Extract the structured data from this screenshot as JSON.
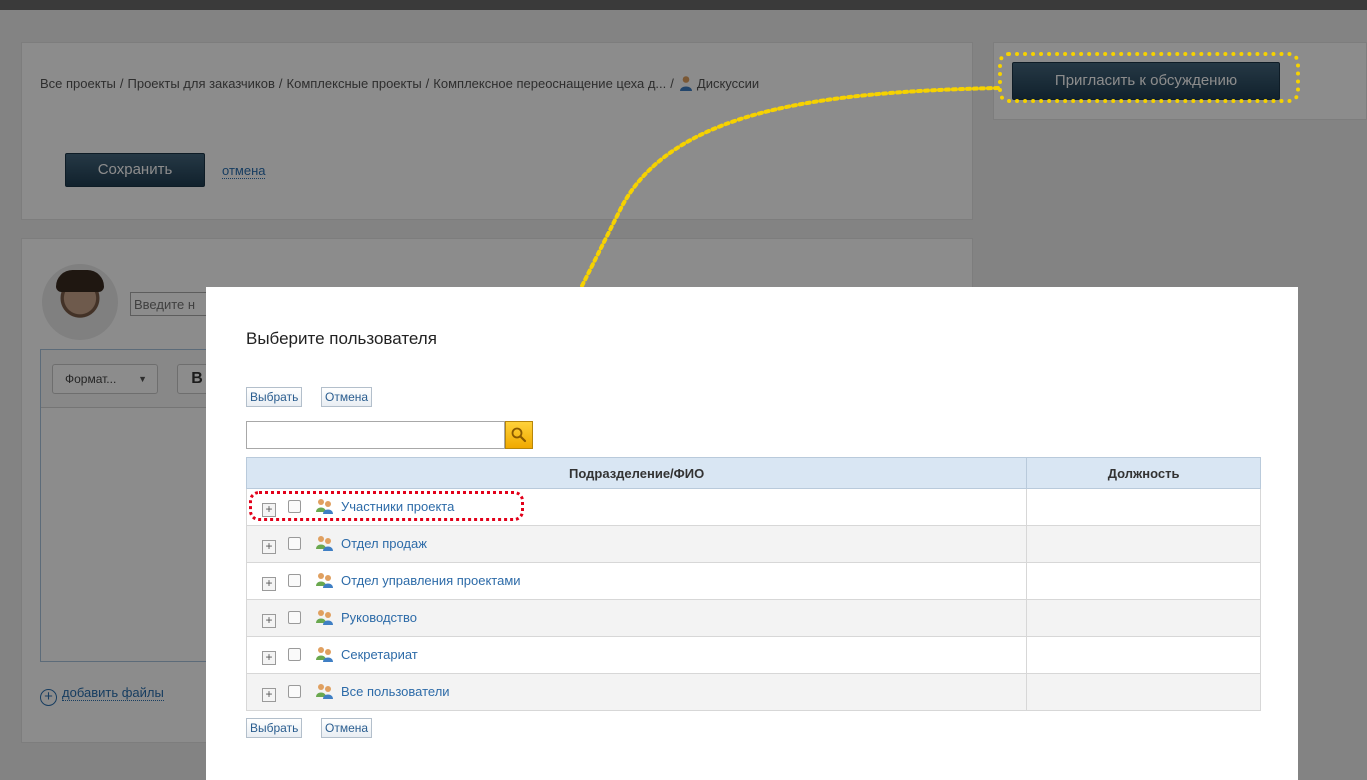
{
  "breadcrumb": {
    "items": [
      "Все проекты",
      "Проекты для заказчиков",
      "Комплексные проекты",
      "Комплексное переоснащение цеха д...",
      "Дискуссии"
    ],
    "separator": "/"
  },
  "form": {
    "save_label": "Сохранить",
    "cancel_label": "отмена"
  },
  "sidebar": {
    "invite_label": "Пригласить к обсуждению"
  },
  "comment": {
    "name_placeholder": "Введите н",
    "format_label": "Формат...",
    "bold_label": "B",
    "add_files_label": "добавить файлы"
  },
  "modal": {
    "title": "Выберите пользователя",
    "select_label": "Выбрать",
    "cancel_label": "Отмена",
    "columns": [
      "Подразделение/ФИО",
      "Должность"
    ],
    "rows": [
      {
        "name": "Участники проекта",
        "position": ""
      },
      {
        "name": "Отдел продаж",
        "position": ""
      },
      {
        "name": "Отдел управления проектами",
        "position": ""
      },
      {
        "name": "Руководство",
        "position": ""
      },
      {
        "name": "Секретариат",
        "position": ""
      },
      {
        "name": "Все пользователи",
        "position": ""
      }
    ]
  },
  "colors": {
    "accent_button": "#2b4b61",
    "link": "#2d6ba8",
    "highlight_yellow": "#f6d200",
    "highlight_red": "#e2001a",
    "table_header": "#d9e6f3"
  },
  "icons": [
    "user-icon",
    "group-icon",
    "search-icon",
    "expand-plus-icon",
    "add-circle-icon"
  ]
}
